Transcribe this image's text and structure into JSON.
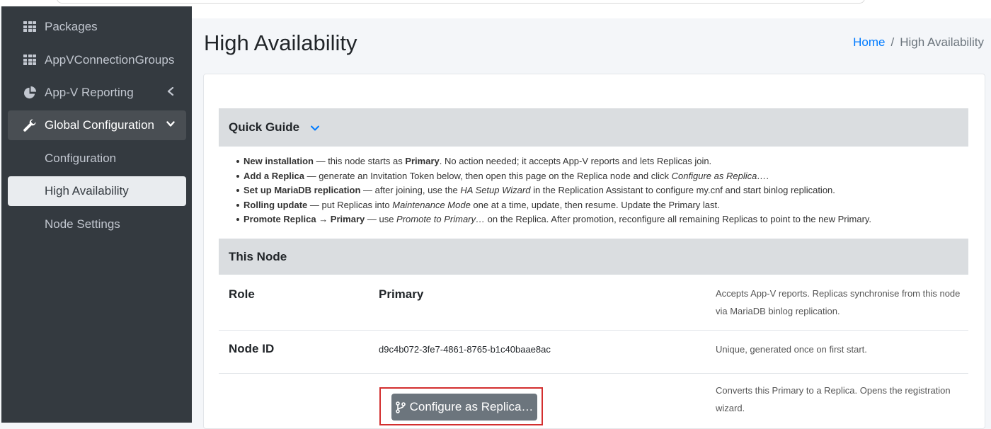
{
  "sidebar": {
    "items": [
      {
        "label": "Packages",
        "icon": "grid-icon"
      },
      {
        "label": "AppVConnectionGroups",
        "icon": "grid-icon"
      },
      {
        "label": "App-V Reporting",
        "icon": "pie-chart-icon"
      },
      {
        "label": "Global Configuration",
        "icon": "wrench-icon"
      },
      {
        "label": "Configuration"
      },
      {
        "label": "High Availability"
      },
      {
        "label": "Node Settings"
      }
    ]
  },
  "header": {
    "title": "High Availability",
    "breadcrumb": {
      "home": "Home",
      "separator": "/",
      "current": "High Availability"
    }
  },
  "quick_guide": {
    "title": "Quick Guide",
    "items": [
      {
        "lead": "New installation",
        "t1": " — this node starts as ",
        "b1": "Primary",
        "t2": ". No action needed; it accepts App-V reports and lets Replicas join."
      },
      {
        "lead": "Add a Replica",
        "t1": " — generate an Invitation Token below, then open this page on the Replica node and click ",
        "i1": "Configure as Replica…",
        "t2": "."
      },
      {
        "lead": "Set up MariaDB replication",
        "t1": " — after joining, use the ",
        "i1": "HA Setup Wizard",
        "t2": " in the Replication Assistant to configure my.cnf and start binlog replication."
      },
      {
        "lead": "Rolling update",
        "t1": " — put Replicas into ",
        "i1": "Maintenance Mode",
        "t2": " one at a time, update, then resume. Update the Primary last."
      },
      {
        "lead": "Promote Replica → Primary",
        "t1": " — use ",
        "i1": "Promote to Primary…",
        "t2": " on the Replica. After promotion, reconfigure all remaining Replicas to point to the new Primary."
      }
    ]
  },
  "this_node": {
    "title": "This Node",
    "role": {
      "label": "Role",
      "value": "Primary",
      "desc": "Accepts App-V reports. Replicas synchronise from this node via MariaDB binlog replication."
    },
    "node_id": {
      "label": "Node ID",
      "value": "d9c4b072-3fe7-4861-8765-b1c40baae8ac",
      "desc": "Unique, generated once on first start."
    },
    "action": {
      "button": "Configure as Replica…",
      "icon": "code-branch-icon",
      "desc": "Converts this Primary to a Replica. Opens the registration wizard."
    }
  },
  "colors": {
    "sidebar_bg": "#343a40",
    "link": "#007bff",
    "highlight": "#d32f2f",
    "button_bg": "#6c757d"
  }
}
